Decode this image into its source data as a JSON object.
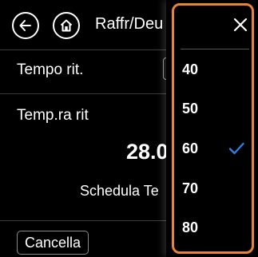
{
  "header": {
    "title": "Raffr/Deu",
    "back_icon": "arrow-left-icon",
    "home_icon": "home-icon"
  },
  "rows": {
    "tempo_label": "Tempo rit.",
    "temp_label": "Temp.ra rit",
    "temp_value": "28.0",
    "schedule_label": "Schedula Te"
  },
  "footer": {
    "cancel_label": "Cancella"
  },
  "dropdown": {
    "close_icon": "close-icon",
    "options": [
      "40",
      "50",
      "60",
      "70",
      "80"
    ],
    "selected": "60",
    "check_icon": "checkmark-icon"
  },
  "colors": {
    "highlight_outline": "#e8843a",
    "check_color": "#2f7fe6",
    "background": "#000000",
    "text": "#ffffff"
  }
}
